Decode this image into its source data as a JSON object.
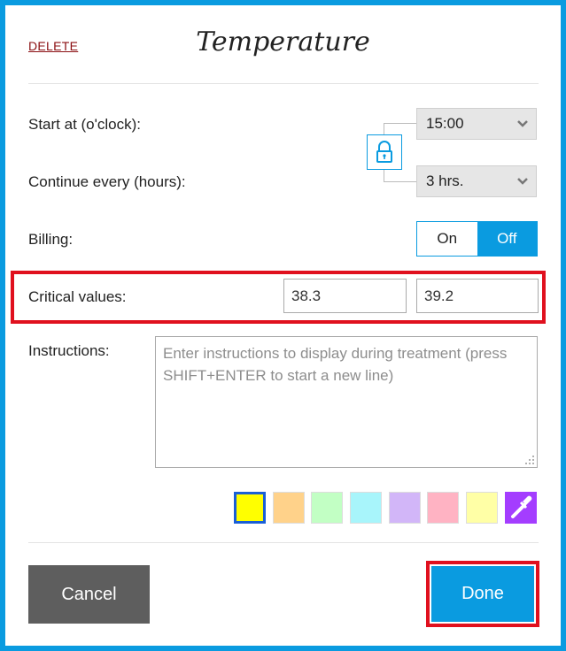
{
  "header": {
    "delete_label": "DELETE",
    "title": "Temperature"
  },
  "fields": {
    "start_label": "Start at (o'clock):",
    "start_value": "15:00",
    "continue_label": "Continue every (hours):",
    "continue_value": "3 hrs.",
    "billing_label": "Billing:",
    "billing_on": "On",
    "billing_off": "Off",
    "billing_selected": "Off",
    "critical_label": "Critical values:",
    "critical_low": "38.3",
    "critical_high": "39.2",
    "instructions_label": "Instructions:",
    "instructions_placeholder": "Enter instructions to display during treatment (press SHIFT+ENTER to start a new line)"
  },
  "colors": {
    "accent": "#0a9be0",
    "highlight": "#e0101e",
    "swatches": [
      "#ffff00",
      "#ffd28a",
      "#c2ffc4",
      "#a8f5fb",
      "#d2b6f8",
      "#ffb3c3",
      "#ffffa6"
    ],
    "selected_swatch": "#ffff00",
    "picker": "#a43dff"
  },
  "icons": {
    "lock": "lock-icon",
    "picker": "eyedropper-icon",
    "chevron": "chevron-down-icon"
  },
  "footer": {
    "cancel_label": "Cancel",
    "done_label": "Done"
  }
}
